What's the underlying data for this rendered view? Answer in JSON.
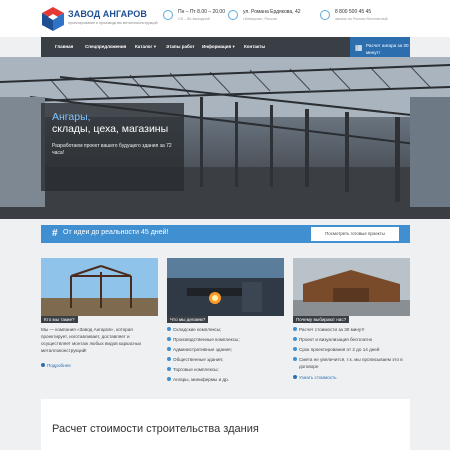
{
  "header": {
    "logo_title": "ЗАВОД АНГАРОВ",
    "logo_subtitle": "проектирование и производство металлоконструкций",
    "hours": {
      "line1": "Пн – Пт 8.00 – 20.00",
      "line2": "Сб – Вс выходной"
    },
    "address": {
      "line1": "ул. Романа Ердякова, 42",
      "line2": "г.Кемерово, Россия"
    },
    "phone": {
      "line1": "8 800 500 45 45",
      "line2": "звонок по России бесплатный"
    }
  },
  "nav": {
    "items": [
      "Главная",
      "Спецпредложения",
      "Каталог",
      "Этапы работ",
      "Информация",
      "Контакты"
    ],
    "cta": "Расчет ангара за 30 минут!"
  },
  "hero": {
    "title_accent": "Ангары,",
    "title_rest": "склады, цеха, магазины",
    "text": "Разработаем проект вашего будущего здания за 72 часа!"
  },
  "band": {
    "icon": "#",
    "text": "От идеи до реальности 45 дней!",
    "button": "Посмотреть готовые проекты"
  },
  "features": [
    {
      "heading": "Кто мы такие?",
      "text": "Мы — компания «Завод Ангаров», которая проектирует, изготавливает, доставляет и осуществляет монтаж любых видов каркасных металлоконструкций!",
      "more": "Подробнее"
    },
    {
      "heading": "Что мы делаем?",
      "items": [
        "Складские комплексы;",
        "Производственные комплексы;",
        "Административные здания;",
        "Общественные здания;",
        "Торговые комплексы;",
        "Ангары, минифермы и др."
      ]
    },
    {
      "heading": "Почему выбирают нас?",
      "items": [
        "Расчет стоимости за 30 минут!",
        "Проект и визуализация бесплатно",
        "Срок проектирования от 2 до 14 дней",
        "Смета не увеличится, т.к. мы прописываем это в договоре"
      ],
      "more": "Узнать стоимость"
    }
  ],
  "calc": {
    "title": "Расчет стоимости строительства здания"
  },
  "colors": {
    "accent": "#3f8fd1",
    "nav": "#3a3f46",
    "brand": "#1f4f93"
  }
}
